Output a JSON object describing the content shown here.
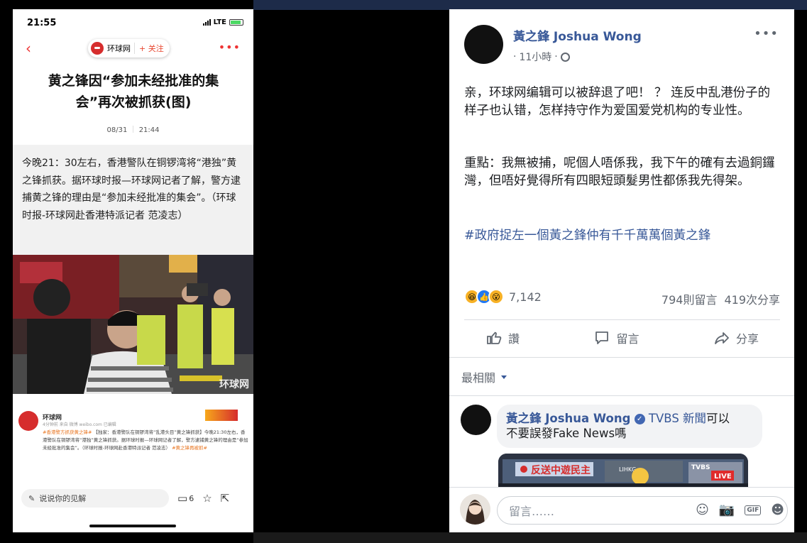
{
  "phone": {
    "status": {
      "time": "21:55",
      "network": "LTE"
    },
    "nav": {
      "back_icon": "chevron-left",
      "source": "环球网",
      "follow": "+ 关注",
      "more": "•••"
    },
    "article": {
      "title": "黄之锋因“参加未经批准的集会”再次被抓获(图)",
      "date": "08/31",
      "time": "21:44",
      "body": "今晚21：30左右，香港警队在铜锣湾将“港独”黄之锋抓获。据环球时报—环球网记者了解，警方逮捕黄之锋的理由是“参加未经批准的集会”。（环球时报-环球网赴香港特派记者 范凌志）",
      "photo_watermark": "环球网"
    },
    "weibo": {
      "name": "环球网",
      "sub": "4分钟前 来自 微博 weibo.com 已编辑",
      "tag1": "#香港警方抓获黄之锋#",
      "text": "【独家：香港警队在铜锣湾将“乱港头目”黄之锋抓获】今晚21:30左右，香港警队在铜锣湾将“港独”黄之锋抓获。据环球时报—环球网记者了解，警方逮捕黄之锋的理由是“参加未经批准的集会”。（环球时报-环球网赴香港特派记者 范凌志）",
      "tag2": "#黄之锋再被抓#"
    },
    "bottom": {
      "comment_placeholder": "说说你的见解",
      "comment_count": "6"
    }
  },
  "post": {
    "author": "黃之鋒 Joshua Wong",
    "time": "11小時",
    "paragraph1": "亲，环球网编辑可以被辞退了吧！ ？ 连反中乱港份子的样子也认错，怎样持守作为爱国爱党机构的专业性。",
    "paragraph2": "重點：我無被捕，呢個人唔係我，我下午的確有去過銅鑼灣，但唔好覺得所有四眼短頭髮男性都係我先得架。",
    "hashtag": "#政府捉左一個黃之鋒仲有千千萬萬個黃之鋒",
    "reactions_count": "7,142",
    "comments_count": "794則留言",
    "shares_count": "419次分享",
    "actions": {
      "like": "讚",
      "comment": "留言",
      "share": "分享"
    },
    "sort_label": "最相關",
    "comment": {
      "name": "黃之鋒 Joshua Wong",
      "tag": "TVBS 新聞",
      "text1": "可以",
      "text2": "不要誤發Fake News嗎"
    },
    "video": {
      "banner": "反送中遊民主",
      "channel": "TVBS",
      "live": "LIVE",
      "logo": "LIHKG"
    },
    "composer_placeholder": "留言……"
  },
  "colors": {
    "fb_blue": "#385898",
    "fb_gray": "#616770",
    "huanqiu_red": "#d62d2d"
  }
}
